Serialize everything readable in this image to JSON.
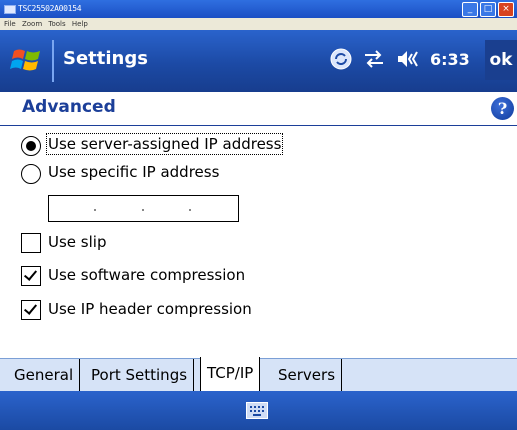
{
  "emulator": {
    "title": "TSC25502A00154",
    "menu": [
      "File",
      "Zoom",
      "Tools",
      "Help"
    ]
  },
  "titlebar": {
    "title": "Settings",
    "time": "6:33",
    "ok": "ok"
  },
  "page": {
    "heading": "Advanced",
    "help": "?"
  },
  "ip_options": [
    {
      "label": "Use server-assigned IP address",
      "selected": true
    },
    {
      "label": "Use specific IP address",
      "selected": false
    }
  ],
  "checkboxes": [
    {
      "label": "Use slip",
      "checked": false
    },
    {
      "label": "Use software compression",
      "checked": true
    },
    {
      "label": "Use IP header compression",
      "checked": true
    }
  ],
  "tabs": [
    {
      "label": "General",
      "active": false
    },
    {
      "label": "Port Settings",
      "active": false
    },
    {
      "label": "TCP/IP",
      "active": true
    },
    {
      "label": "Servers",
      "active": false
    }
  ],
  "colors": {
    "accent": "#1c3f99",
    "bar": "#1c4aa5"
  }
}
